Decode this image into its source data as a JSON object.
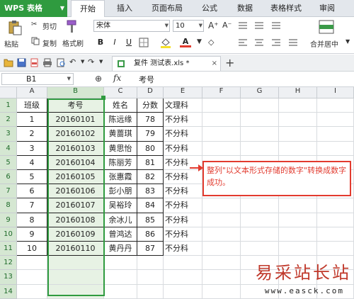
{
  "app": {
    "name": "WPS 表格"
  },
  "tabs": [
    "开始",
    "插入",
    "页面布局",
    "公式",
    "数据",
    "表格样式",
    "审阅"
  ],
  "ribbon": {
    "paste": "粘贴",
    "cut": "剪切",
    "copy": "复制",
    "format_painter": "格式刷",
    "font_name": "宋体",
    "font_size": "10",
    "merge_center": "合并居中",
    "bold": "B",
    "italic": "I",
    "underline": "U",
    "font_color_letter": "A"
  },
  "doc_tab": {
    "name": "复件 测试表.xls *"
  },
  "formula_bar": {
    "name_box": "B1",
    "fx": "fx",
    "content": "考号"
  },
  "columns": [
    "A",
    "B",
    "C",
    "D",
    "E",
    "F",
    "G",
    "H",
    "I"
  ],
  "rows": [
    "1",
    "2",
    "3",
    "4",
    "5",
    "6",
    "7",
    "8",
    "9",
    "10",
    "11",
    "12",
    "13",
    "14"
  ],
  "sheet": {
    "headers": [
      "班级",
      "考号",
      "姓名",
      "分数",
      "文理科"
    ],
    "data": [
      [
        "1",
        "20160101",
        "陈远缘",
        "78",
        "不分科"
      ],
      [
        "2",
        "20160102",
        "黄蔷琪",
        "79",
        "不分科"
      ],
      [
        "3",
        "20160103",
        "黄思怡",
        "80",
        "不分科"
      ],
      [
        "4",
        "20160104",
        "陈丽芳",
        "81",
        "不分科"
      ],
      [
        "5",
        "20160105",
        "张惠霞",
        "82",
        "不分科"
      ],
      [
        "6",
        "20160106",
        "彭小朋",
        "83",
        "不分科"
      ],
      [
        "7",
        "20160107",
        "吴裕玲",
        "84",
        "不分科"
      ],
      [
        "8",
        "20160108",
        "余冰儿",
        "85",
        "不分科"
      ],
      [
        "9",
        "20160109",
        "曾鸿达",
        "86",
        "不分科"
      ],
      [
        "10",
        "20160110",
        "黄丹丹",
        "87",
        "不分科"
      ]
    ]
  },
  "annotation": "整列\"以文本形式存储的数字\"转换成数字成功。",
  "watermark": {
    "title": "易采站长站",
    "url": "www.easck.com"
  },
  "colors": {
    "accent": "#2f9b3f",
    "annotation": "#e23b2f"
  }
}
